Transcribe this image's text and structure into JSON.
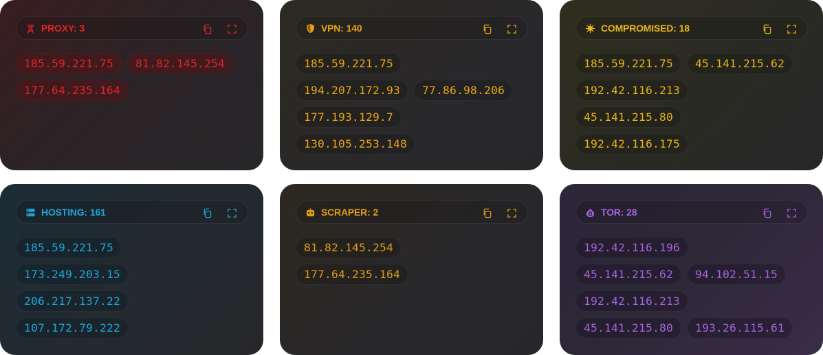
{
  "cards": [
    {
      "type": "PROXY",
      "count": "3",
      "icon": "proxy-tower-icon",
      "color": "#dc2626",
      "ips": [
        "185.59.221.75",
        "81.82.145.254",
        "177.64.235.164"
      ]
    },
    {
      "type": "VPN",
      "count": "140",
      "icon": "shield-icon",
      "color": "#e9a413",
      "ips": [
        "185.59.221.75",
        "194.207.172.93",
        "77.86.98.206",
        "177.193.129.7",
        "130.105.253.148"
      ]
    },
    {
      "type": "COMPROMISED",
      "count": "18",
      "icon": "bug-icon",
      "color": "#e5b419",
      "ips": [
        "185.59.221.75",
        "45.141.215.62",
        "192.42.116.213",
        "45.141.215.80",
        "192.42.116.175"
      ]
    },
    {
      "type": "HOSTING",
      "count": "161",
      "icon": "server-icon",
      "color": "#21a3d4",
      "ips": [
        "185.59.221.75",
        "173.249.203.15",
        "206.217.137.22",
        "107.172.79.222"
      ]
    },
    {
      "type": "SCRAPER",
      "count": "2",
      "icon": "robot-icon",
      "color": "#e19a16",
      "ips": [
        "81.82.145.254",
        "177.64.235.164"
      ]
    },
    {
      "type": "TOR",
      "count": "28",
      "icon": "onion-icon",
      "color": "#a463dc",
      "ips": [
        "192.42.116.196",
        "45.141.215.62",
        "94.102.51.15",
        "192.42.116.213",
        "45.141.215.80",
        "193.26.115.61"
      ]
    }
  ],
  "controls": {
    "copy_icon": "copy-icon",
    "expand_icon": "expand-icon"
  }
}
